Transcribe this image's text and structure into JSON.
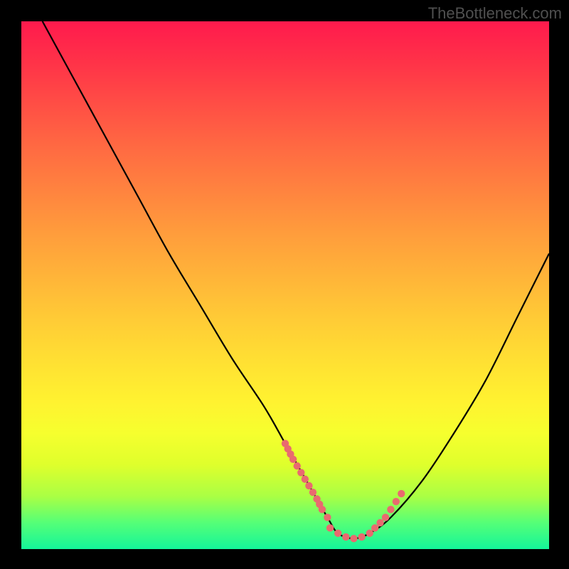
{
  "attribution": "TheBottleneck.com",
  "chart_data": {
    "type": "line",
    "title": "",
    "xlabel": "",
    "ylabel": "",
    "xlim": [
      0,
      100
    ],
    "ylim": [
      0,
      100
    ],
    "grid": false,
    "legend": false,
    "description": "Bottleneck curve: V-shaped performance mismatch curve drawn over a vertical heat gradient (red = high bottleneck at top, green = no bottleneck at bottom). Left branch descends steeply from ~100% at x≈4 to the trough; right branch rises more gently to ~55% at x≈100. Minimum (optimal pairing) lies roughly around x≈60–64 at y≈2.",
    "series": [
      {
        "name": "bottleneck-curve",
        "color": "#000000",
        "x": [
          4,
          10,
          16,
          22,
          28,
          34,
          40,
          46,
          50,
          54,
          58,
          60,
          63,
          66,
          70,
          76,
          82,
          88,
          94,
          100
        ],
        "y": [
          100,
          89,
          78,
          67,
          56,
          46,
          36,
          27,
          20,
          13,
          6,
          3,
          2,
          3,
          6,
          13,
          22,
          32,
          44,
          56
        ]
      }
    ],
    "highlight_segments": {
      "color": "#e96a6f",
      "note": "coral dotted bead segments on descending and ascending flanks near the trough and a flat beaded run along the minimum",
      "left_flank": {
        "x": [
          50,
          51.5,
          53,
          54.5,
          56,
          57,
          58
        ],
        "y": [
          20,
          17,
          14.5,
          12,
          9.5,
          7.5,
          6
        ]
      },
      "trough": {
        "x": [
          58.5,
          60,
          61.5,
          63,
          64.5,
          66
        ],
        "y": [
          4,
          3,
          2.3,
          2,
          2.3,
          3
        ]
      },
      "right_flank": {
        "x": [
          67,
          68,
          69,
          70,
          71,
          72
        ],
        "y": [
          4,
          5,
          6,
          7.5,
          9,
          10.5
        ]
      }
    }
  }
}
